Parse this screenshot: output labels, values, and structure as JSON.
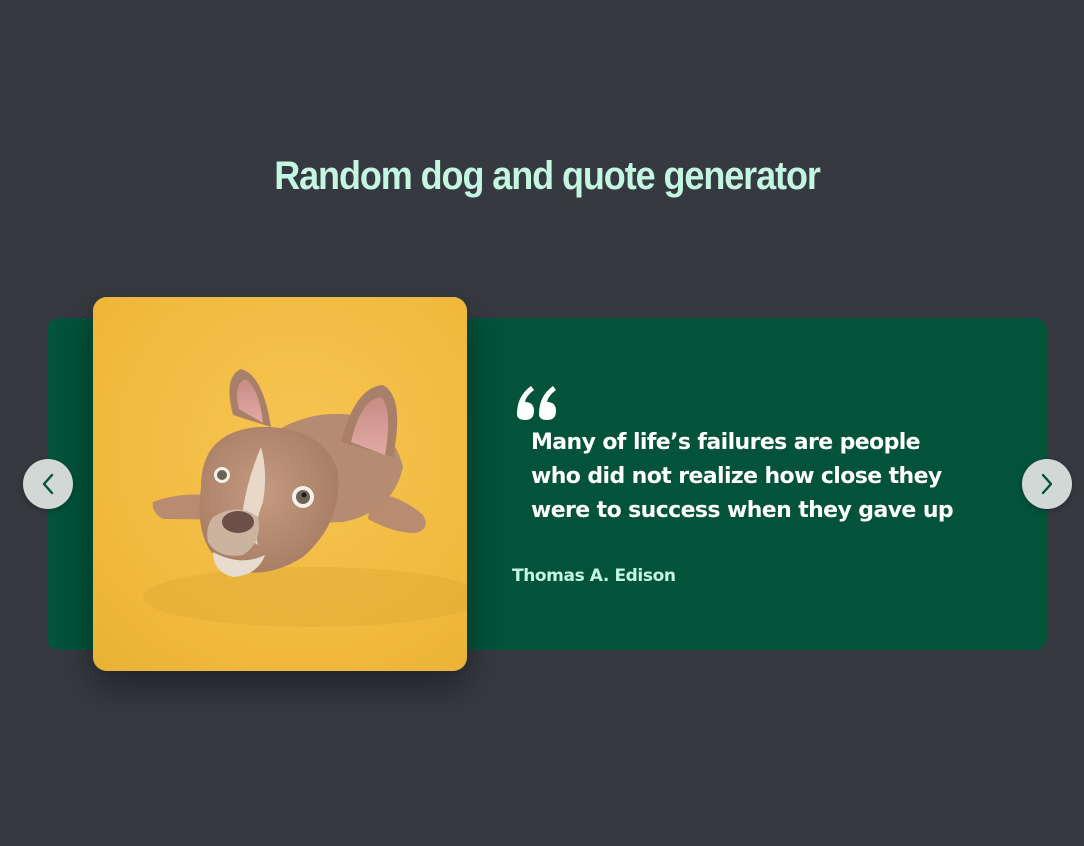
{
  "page": {
    "title": "Random dog and quote generator"
  },
  "slide": {
    "image": {
      "icon": "french-bulldog-photo",
      "background_color": "#f2bf46"
    },
    "quote_icon": "quote-open-icon",
    "quote": "Many of life’s failures are people who did not realize how close they were to success when they gave up",
    "author": "Thomas A. Edison"
  },
  "navigation": {
    "prev_icon": "chevron-left-icon",
    "next_icon": "chevron-right-icon"
  },
  "colors": {
    "background": "#363940",
    "card": "#03523a",
    "title": "#c4f7e1",
    "quote_text": "#ffffff",
    "author": "#c4f7e1",
    "nav_button": "#d1d8d6",
    "nav_icon": "#03523a"
  }
}
